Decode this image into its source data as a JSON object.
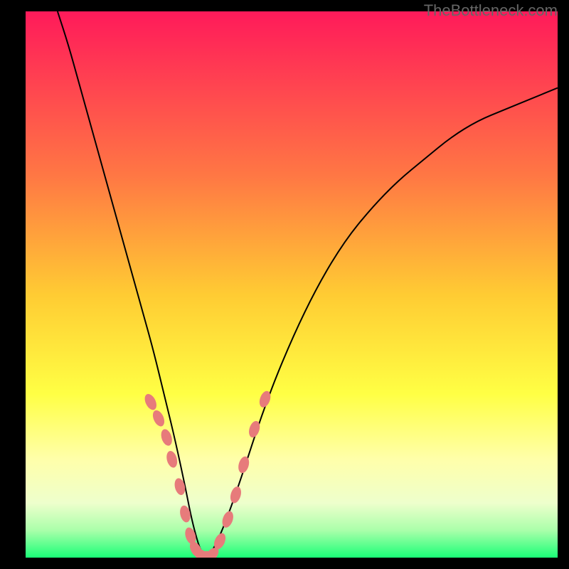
{
  "watermark": "TheBottleneck.com",
  "chart_data": {
    "type": "line",
    "title": "",
    "xlabel": "",
    "ylabel": "",
    "x_range": [
      0,
      100
    ],
    "y_range": [
      0,
      100
    ],
    "series": [
      {
        "name": "bottleneck-curve",
        "x": [
          6,
          8,
          10,
          12,
          14,
          16,
          18,
          20,
          22,
          24,
          26,
          28,
          30,
          31,
          32,
          33,
          34,
          35,
          37,
          40,
          45,
          50,
          55,
          60,
          65,
          70,
          75,
          80,
          85,
          90,
          95,
          100
        ],
        "y": [
          100,
          94,
          87,
          80,
          73,
          66,
          59,
          52,
          45,
          38,
          30,
          22,
          13,
          8,
          4,
          1,
          0,
          1,
          5,
          13,
          28,
          40,
          50,
          58,
          64,
          69,
          73,
          77,
          80,
          82,
          84,
          86
        ]
      }
    ],
    "markers": {
      "name": "data-points",
      "x": [
        23.5,
        25,
        26.5,
        27.5,
        29,
        30,
        31,
        32,
        33,
        34,
        35,
        36.5,
        38,
        39.5,
        41,
        43,
        45
      ],
      "y": [
        28.5,
        25.5,
        22,
        18,
        13,
        8,
        4,
        1.5,
        0.5,
        0.3,
        0.5,
        3,
        7,
        11.5,
        17,
        23.5,
        29
      ]
    },
    "gradient_background": {
      "top": "#ff1a5a",
      "mid1": "#ff9933",
      "mid2": "#ffff33",
      "mid3": "#ffffcc",
      "bottom": "#1aff77"
    }
  }
}
